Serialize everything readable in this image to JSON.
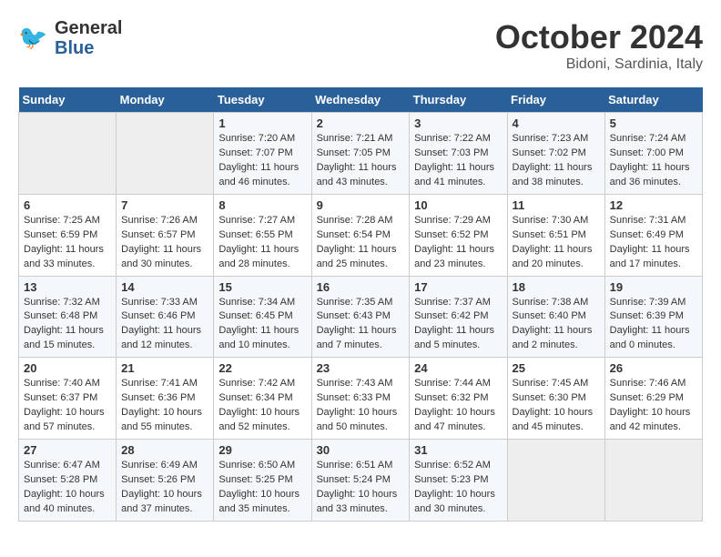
{
  "header": {
    "logo_general": "General",
    "logo_blue": "Blue",
    "title": "October 2024",
    "location": "Bidoni, Sardinia, Italy"
  },
  "days_of_week": [
    "Sunday",
    "Monday",
    "Tuesday",
    "Wednesday",
    "Thursday",
    "Friday",
    "Saturday"
  ],
  "weeks": [
    [
      {
        "day": "",
        "sunrise": "",
        "sunset": "",
        "daylight": ""
      },
      {
        "day": "",
        "sunrise": "",
        "sunset": "",
        "daylight": ""
      },
      {
        "day": "1",
        "sunrise": "Sunrise: 7:20 AM",
        "sunset": "Sunset: 7:07 PM",
        "daylight": "Daylight: 11 hours and 46 minutes."
      },
      {
        "day": "2",
        "sunrise": "Sunrise: 7:21 AM",
        "sunset": "Sunset: 7:05 PM",
        "daylight": "Daylight: 11 hours and 43 minutes."
      },
      {
        "day": "3",
        "sunrise": "Sunrise: 7:22 AM",
        "sunset": "Sunset: 7:03 PM",
        "daylight": "Daylight: 11 hours and 41 minutes."
      },
      {
        "day": "4",
        "sunrise": "Sunrise: 7:23 AM",
        "sunset": "Sunset: 7:02 PM",
        "daylight": "Daylight: 11 hours and 38 minutes."
      },
      {
        "day": "5",
        "sunrise": "Sunrise: 7:24 AM",
        "sunset": "Sunset: 7:00 PM",
        "daylight": "Daylight: 11 hours and 36 minutes."
      }
    ],
    [
      {
        "day": "6",
        "sunrise": "Sunrise: 7:25 AM",
        "sunset": "Sunset: 6:59 PM",
        "daylight": "Daylight: 11 hours and 33 minutes."
      },
      {
        "day": "7",
        "sunrise": "Sunrise: 7:26 AM",
        "sunset": "Sunset: 6:57 PM",
        "daylight": "Daylight: 11 hours and 30 minutes."
      },
      {
        "day": "8",
        "sunrise": "Sunrise: 7:27 AM",
        "sunset": "Sunset: 6:55 PM",
        "daylight": "Daylight: 11 hours and 28 minutes."
      },
      {
        "day": "9",
        "sunrise": "Sunrise: 7:28 AM",
        "sunset": "Sunset: 6:54 PM",
        "daylight": "Daylight: 11 hours and 25 minutes."
      },
      {
        "day": "10",
        "sunrise": "Sunrise: 7:29 AM",
        "sunset": "Sunset: 6:52 PM",
        "daylight": "Daylight: 11 hours and 23 minutes."
      },
      {
        "day": "11",
        "sunrise": "Sunrise: 7:30 AM",
        "sunset": "Sunset: 6:51 PM",
        "daylight": "Daylight: 11 hours and 20 minutes."
      },
      {
        "day": "12",
        "sunrise": "Sunrise: 7:31 AM",
        "sunset": "Sunset: 6:49 PM",
        "daylight": "Daylight: 11 hours and 17 minutes."
      }
    ],
    [
      {
        "day": "13",
        "sunrise": "Sunrise: 7:32 AM",
        "sunset": "Sunset: 6:48 PM",
        "daylight": "Daylight: 11 hours and 15 minutes."
      },
      {
        "day": "14",
        "sunrise": "Sunrise: 7:33 AM",
        "sunset": "Sunset: 6:46 PM",
        "daylight": "Daylight: 11 hours and 12 minutes."
      },
      {
        "day": "15",
        "sunrise": "Sunrise: 7:34 AM",
        "sunset": "Sunset: 6:45 PM",
        "daylight": "Daylight: 11 hours and 10 minutes."
      },
      {
        "day": "16",
        "sunrise": "Sunrise: 7:35 AM",
        "sunset": "Sunset: 6:43 PM",
        "daylight": "Daylight: 11 hours and 7 minutes."
      },
      {
        "day": "17",
        "sunrise": "Sunrise: 7:37 AM",
        "sunset": "Sunset: 6:42 PM",
        "daylight": "Daylight: 11 hours and 5 minutes."
      },
      {
        "day": "18",
        "sunrise": "Sunrise: 7:38 AM",
        "sunset": "Sunset: 6:40 PM",
        "daylight": "Daylight: 11 hours and 2 minutes."
      },
      {
        "day": "19",
        "sunrise": "Sunrise: 7:39 AM",
        "sunset": "Sunset: 6:39 PM",
        "daylight": "Daylight: 11 hours and 0 minutes."
      }
    ],
    [
      {
        "day": "20",
        "sunrise": "Sunrise: 7:40 AM",
        "sunset": "Sunset: 6:37 PM",
        "daylight": "Daylight: 10 hours and 57 minutes."
      },
      {
        "day": "21",
        "sunrise": "Sunrise: 7:41 AM",
        "sunset": "Sunset: 6:36 PM",
        "daylight": "Daylight: 10 hours and 55 minutes."
      },
      {
        "day": "22",
        "sunrise": "Sunrise: 7:42 AM",
        "sunset": "Sunset: 6:34 PM",
        "daylight": "Daylight: 10 hours and 52 minutes."
      },
      {
        "day": "23",
        "sunrise": "Sunrise: 7:43 AM",
        "sunset": "Sunset: 6:33 PM",
        "daylight": "Daylight: 10 hours and 50 minutes."
      },
      {
        "day": "24",
        "sunrise": "Sunrise: 7:44 AM",
        "sunset": "Sunset: 6:32 PM",
        "daylight": "Daylight: 10 hours and 47 minutes."
      },
      {
        "day": "25",
        "sunrise": "Sunrise: 7:45 AM",
        "sunset": "Sunset: 6:30 PM",
        "daylight": "Daylight: 10 hours and 45 minutes."
      },
      {
        "day": "26",
        "sunrise": "Sunrise: 7:46 AM",
        "sunset": "Sunset: 6:29 PM",
        "daylight": "Daylight: 10 hours and 42 minutes."
      }
    ],
    [
      {
        "day": "27",
        "sunrise": "Sunrise: 6:47 AM",
        "sunset": "Sunset: 5:28 PM",
        "daylight": "Daylight: 10 hours and 40 minutes."
      },
      {
        "day": "28",
        "sunrise": "Sunrise: 6:49 AM",
        "sunset": "Sunset: 5:26 PM",
        "daylight": "Daylight: 10 hours and 37 minutes."
      },
      {
        "day": "29",
        "sunrise": "Sunrise: 6:50 AM",
        "sunset": "Sunset: 5:25 PM",
        "daylight": "Daylight: 10 hours and 35 minutes."
      },
      {
        "day": "30",
        "sunrise": "Sunrise: 6:51 AM",
        "sunset": "Sunset: 5:24 PM",
        "daylight": "Daylight: 10 hours and 33 minutes."
      },
      {
        "day": "31",
        "sunrise": "Sunrise: 6:52 AM",
        "sunset": "Sunset: 5:23 PM",
        "daylight": "Daylight: 10 hours and 30 minutes."
      },
      {
        "day": "",
        "sunrise": "",
        "sunset": "",
        "daylight": ""
      },
      {
        "day": "",
        "sunrise": "",
        "sunset": "",
        "daylight": ""
      }
    ]
  ]
}
